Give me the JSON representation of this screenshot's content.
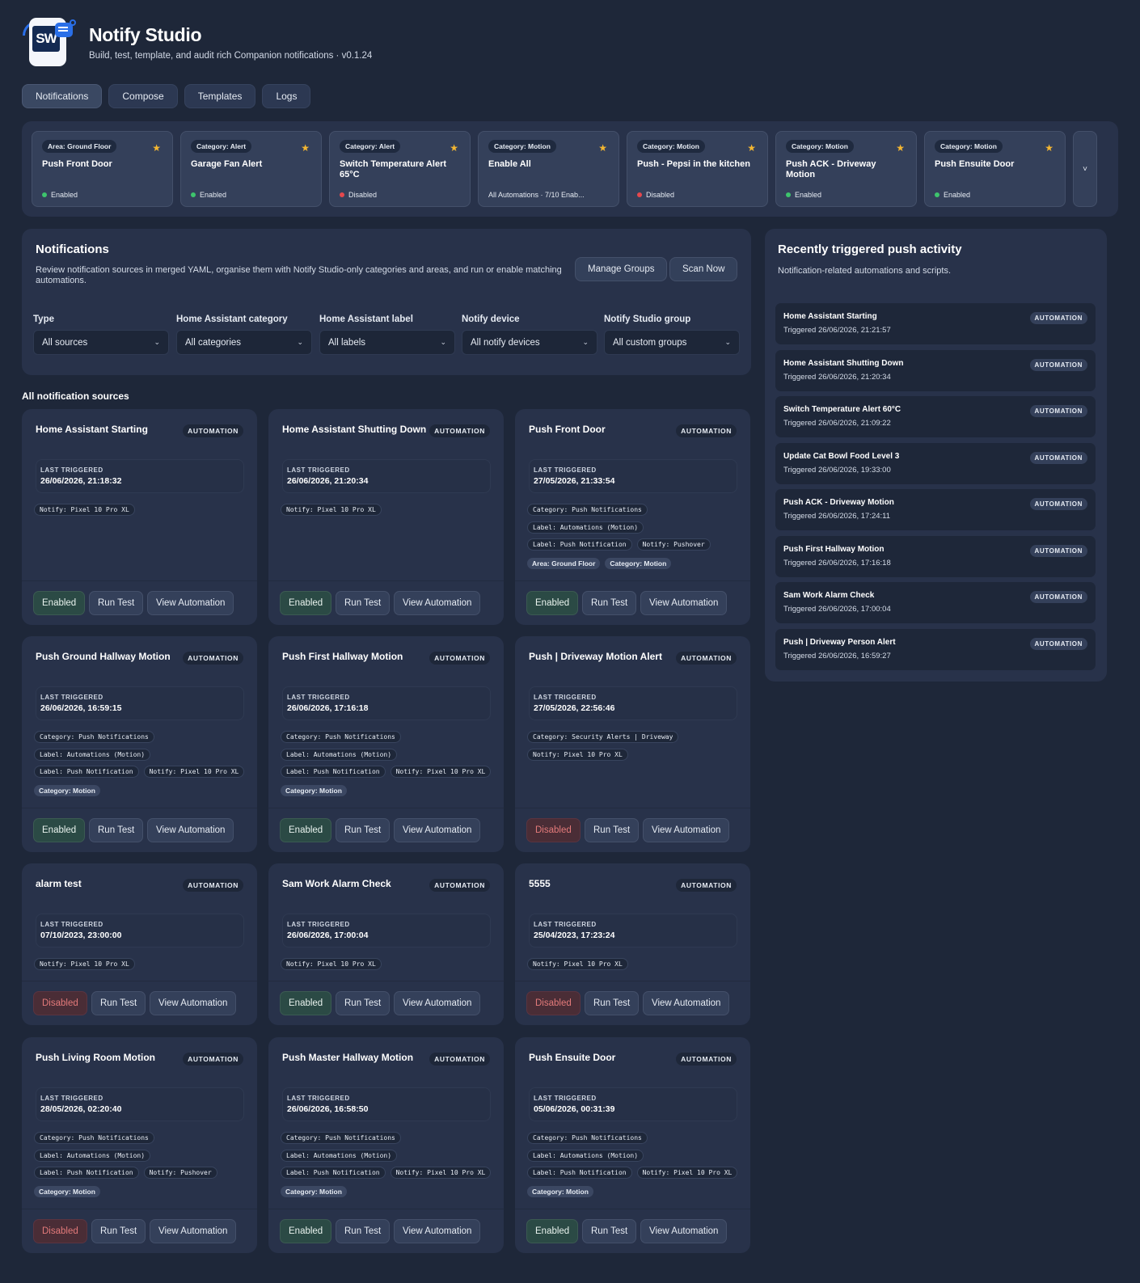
{
  "app": {
    "title": "Notify Studio",
    "subtitle": "Build, test, template, and audit rich Companion notifications · v0.1.24",
    "logo_text": "SW"
  },
  "tabs": [
    {
      "label": "Notifications",
      "active": true
    },
    {
      "label": "Compose",
      "active": false
    },
    {
      "label": "Templates",
      "active": false
    },
    {
      "label": "Logs",
      "active": false
    }
  ],
  "favorites": [
    {
      "chip": "Area: Ground Floor",
      "name": "Push Front Door",
      "status": "Enabled",
      "state": "on"
    },
    {
      "chip": "Category: Alert",
      "name": "Garage Fan Alert",
      "status": "Enabled",
      "state": "on"
    },
    {
      "chip": "Category: Alert",
      "name": "Switch Temperature Alert 65°C",
      "status": "Disabled",
      "state": "off"
    },
    {
      "chip": "Category: Motion",
      "name": "Enable All",
      "status": "All Automations · 7/10 Enab...",
      "state": "none"
    },
    {
      "chip": "Category: Motion",
      "name": "Push - Pepsi in the kitchen",
      "status": "Disabled",
      "state": "off"
    },
    {
      "chip": "Category: Motion",
      "name": "Push ACK - Driveway Motion",
      "status": "Enabled",
      "state": "on"
    },
    {
      "chip": "Category: Motion",
      "name": "Push Ensuite Door",
      "status": "Enabled",
      "state": "on"
    }
  ],
  "favorites_more_icon": "chevron-down",
  "notifications_panel": {
    "title": "Notifications",
    "description": "Review notification sources in merged YAML, organise them with Notify Studio-only categories and areas, and run or enable matching automations.",
    "manage_groups_label": "Manage Groups",
    "scan_now_label": "Scan Now",
    "filters": [
      {
        "label": "Type",
        "value": "All sources"
      },
      {
        "label": "Home Assistant category",
        "value": "All categories"
      },
      {
        "label": "Home Assistant label",
        "value": "All labels"
      },
      {
        "label": "Notify device",
        "value": "All notify devices"
      },
      {
        "label": "Notify Studio group",
        "value": "All custom groups"
      }
    ]
  },
  "sources_title": "All notification sources",
  "labels": {
    "last_triggered": "LAST TRIGGERED",
    "run_test": "Run Test",
    "view_automation": "View Automation",
    "type_badge": "AUTOMATION"
  },
  "sources": [
    {
      "name": "Home Assistant Starting",
      "last": "26/06/2026, 21:18:32",
      "status": "Enabled",
      "state": "on",
      "tags": [
        [
          "Notify: Pixel 10 Pro XL"
        ]
      ],
      "chips": []
    },
    {
      "name": "Home Assistant Shutting Down",
      "last": "26/06/2026, 21:20:34",
      "status": "Enabled",
      "state": "on",
      "tags": [
        [
          "Notify: Pixel 10 Pro XL"
        ]
      ],
      "chips": []
    },
    {
      "name": "Push Front Door",
      "last": "27/05/2026, 21:33:54",
      "status": "Enabled",
      "state": "on",
      "tags": [
        [
          "Category: Push Notifications"
        ],
        [
          "Label: Automations (Motion)"
        ],
        [
          "Label: Push Notification",
          "Notify: Pushover"
        ]
      ],
      "chips": [
        "Area: Ground Floor",
        "Category: Motion"
      ]
    },
    {
      "name": "Push Ground Hallway Motion",
      "last": "26/06/2026, 16:59:15",
      "status": "Enabled",
      "state": "on",
      "tags": [
        [
          "Category: Push Notifications"
        ],
        [
          "Label: Automations (Motion)"
        ],
        [
          "Label: Push Notification",
          "Notify: Pixel 10 Pro XL"
        ]
      ],
      "chips": [
        "Category: Motion"
      ]
    },
    {
      "name": "Push First Hallway Motion",
      "last": "26/06/2026, 17:16:18",
      "status": "Enabled",
      "state": "on",
      "tags": [
        [
          "Category: Push Notifications"
        ],
        [
          "Label: Automations (Motion)"
        ],
        [
          "Label: Push Notification",
          "Notify: Pixel 10 Pro XL"
        ]
      ],
      "chips": [
        "Category: Motion"
      ]
    },
    {
      "name": "Push | Driveway Motion Alert",
      "last": "27/05/2026, 22:56:46",
      "status": "Disabled",
      "state": "off",
      "tags": [
        [
          "Category: Security Alerts | Driveway"
        ],
        [
          "Notify: Pixel 10 Pro XL"
        ]
      ],
      "chips": []
    },
    {
      "name": "alarm test",
      "last": "07/10/2023, 23:00:00",
      "status": "Disabled",
      "state": "off",
      "tags": [
        [
          "Notify: Pixel 10 Pro XL"
        ]
      ],
      "chips": []
    },
    {
      "name": "Sam Work Alarm Check",
      "last": "26/06/2026, 17:00:04",
      "status": "Enabled",
      "state": "on",
      "tags": [
        [
          "Notify: Pixel 10 Pro XL"
        ]
      ],
      "chips": []
    },
    {
      "name": "5555",
      "last": "25/04/2023, 17:23:24",
      "status": "Disabled",
      "state": "off",
      "tags": [
        [
          "Notify: Pixel 10 Pro XL"
        ]
      ],
      "chips": []
    },
    {
      "name": "Push Living Room Motion",
      "last": "28/05/2026, 02:20:40",
      "status": "Disabled",
      "state": "off",
      "tags": [
        [
          "Category: Push Notifications"
        ],
        [
          "Label: Automations (Motion)"
        ],
        [
          "Label: Push Notification",
          "Notify: Pushover"
        ]
      ],
      "chips": [
        "Category: Motion"
      ]
    },
    {
      "name": "Push Master Hallway Motion",
      "last": "26/06/2026, 16:58:50",
      "status": "Enabled",
      "state": "on",
      "tags": [
        [
          "Category: Push Notifications"
        ],
        [
          "Label: Automations (Motion)"
        ],
        [
          "Label: Push Notification",
          "Notify: Pixel 10 Pro XL"
        ]
      ],
      "chips": [
        "Category: Motion"
      ]
    },
    {
      "name": "Push Ensuite Door",
      "last": "05/06/2026, 00:31:39",
      "status": "Enabled",
      "state": "on",
      "tags": [
        [
          "Category: Push Notifications"
        ],
        [
          "Label: Automations (Motion)"
        ],
        [
          "Label: Push Notification",
          "Notify: Pixel 10 Pro XL"
        ]
      ],
      "chips": [
        "Category: Motion"
      ]
    }
  ],
  "activity": {
    "title": "Recently triggered push activity",
    "subtitle": "Notification-related automations and scripts.",
    "items": [
      {
        "name": "Home Assistant Starting",
        "time": "Triggered 26/06/2026, 21:21:57",
        "badge": "AUTOMATION"
      },
      {
        "name": "Home Assistant Shutting Down",
        "time": "Triggered 26/06/2026, 21:20:34",
        "badge": "AUTOMATION"
      },
      {
        "name": "Switch Temperature Alert 60°C",
        "time": "Triggered 26/06/2026, 21:09:22",
        "badge": "AUTOMATION"
      },
      {
        "name": "Update Cat Bowl Food Level 3",
        "time": "Triggered 26/06/2026, 19:33:00",
        "badge": "AUTOMATION"
      },
      {
        "name": "Push ACK - Driveway Motion",
        "time": "Triggered 26/06/2026, 17:24:11",
        "badge": "AUTOMATION"
      },
      {
        "name": "Push First Hallway Motion",
        "time": "Triggered 26/06/2026, 17:16:18",
        "badge": "AUTOMATION"
      },
      {
        "name": "Sam Work Alarm Check",
        "time": "Triggered 26/06/2026, 17:00:04",
        "badge": "AUTOMATION"
      },
      {
        "name": "Push | Driveway Person Alert",
        "time": "Triggered 26/06/2026, 16:59:27",
        "badge": "AUTOMATION"
      }
    ]
  },
  "colors": {
    "background": "#1e2739",
    "panel": "#28324a",
    "enabled_green": "#3ec46d",
    "disabled_red": "#e5484d",
    "star": "#f5b731",
    "brand_blue": "#2a6fe8"
  }
}
